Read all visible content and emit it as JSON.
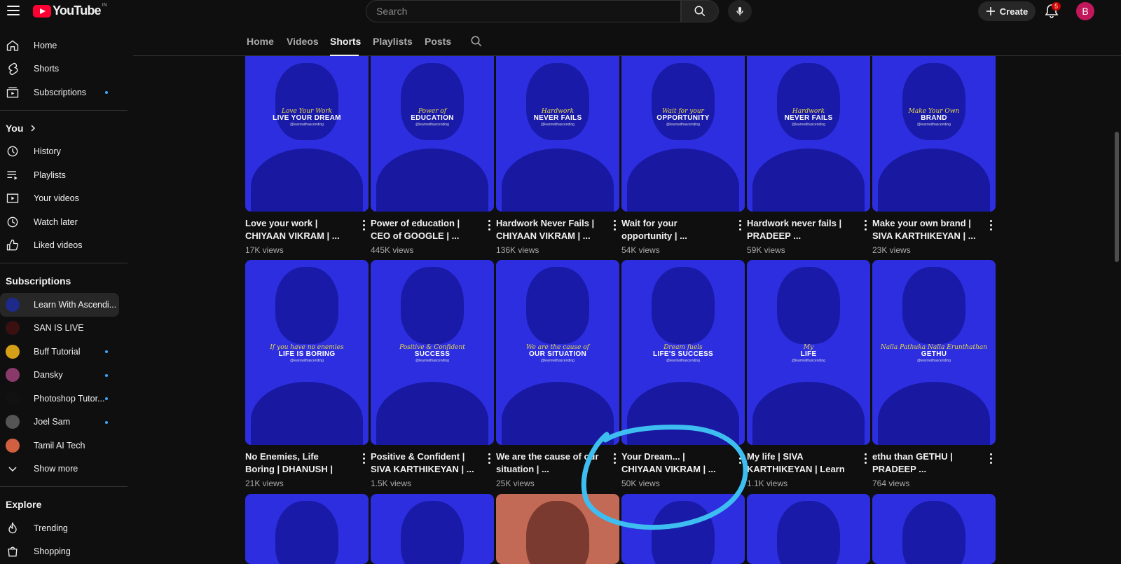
{
  "topbar": {
    "logo_text": "YouTube",
    "country_code": "IN",
    "search_placeholder": "Search",
    "create_label": "Create",
    "notification_count": "5",
    "avatar_letter": "B"
  },
  "sidebar": {
    "main": [
      {
        "label": "Home",
        "icon": "home-icon"
      },
      {
        "label": "Shorts",
        "icon": "shorts-icon"
      },
      {
        "label": "Subscriptions",
        "icon": "subscriptions-icon",
        "dot": true
      }
    ],
    "you_heading": "You",
    "you": [
      {
        "label": "History",
        "icon": "history-icon"
      },
      {
        "label": "Playlists",
        "icon": "playlists-icon"
      },
      {
        "label": "Your videos",
        "icon": "your-videos-icon"
      },
      {
        "label": "Watch later",
        "icon": "watch-later-icon"
      },
      {
        "label": "Liked videos",
        "icon": "liked-videos-icon"
      }
    ],
    "subs_heading": "Subscriptions",
    "subs": [
      {
        "label": "Learn With Ascendi...",
        "color": "#1e2a8a",
        "dot": false,
        "active": true
      },
      {
        "label": "SAN IS LIVE",
        "color": "#3a1010",
        "dot": false
      },
      {
        "label": "Buff Tutorial",
        "color": "#d4a017",
        "dot": true
      },
      {
        "label": "Dansky",
        "color": "#8a3a6a",
        "dot": true
      },
      {
        "label": "Photoshop Tutor...",
        "color": "#111111",
        "dot": true
      },
      {
        "label": "Joel Sam",
        "color": "#555555",
        "dot": true
      },
      {
        "label": "Tamil AI Tech",
        "color": "#d06040",
        "dot": false
      }
    ],
    "show_more": "Show more",
    "explore_heading": "Explore",
    "explore": [
      {
        "label": "Trending",
        "icon": "trending-icon"
      },
      {
        "label": "Shopping",
        "icon": "shopping-icon"
      }
    ]
  },
  "tabs": [
    "Home",
    "Videos",
    "Shorts",
    "Playlists",
    "Posts"
  ],
  "active_tab": "Shorts",
  "shorts_row1": [
    {
      "title": "Love your work  |  CHIYAAN VIKRAM | ...",
      "views": "17K views",
      "cap1": "Love Your Work",
      "cap2": "LIVE YOUR DREAM"
    },
    {
      "title": "Power of education | CEO of GOOGLE | ...",
      "views": "445K views",
      "cap1": "Power of",
      "cap2": "EDUCATION"
    },
    {
      "title": "Hardwork Never Fails  | CHIYAAN VIKRAM | ...",
      "views": "136K views",
      "cap1": "Hardwork",
      "cap2": "NEVER FAILS"
    },
    {
      "title": "Wait for your opportunity | ...",
      "views": "54K views",
      "cap1": "Wait for your",
      "cap2": "OPPORTUNITY"
    },
    {
      "title": "Hardwork never fails  | PRADEEP ...",
      "views": "59K views",
      "cap1": "Hardwork",
      "cap2": "NEVER FAILS"
    },
    {
      "title": "Make your own brand | SIVA KARTHIKEYAN | ...",
      "views": "23K views",
      "cap1": "Make Your Own",
      "cap2": "BRAND"
    }
  ],
  "shorts_row2": [
    {
      "title": "No Enemies, Life Boring | DHANUSH | Learn wit...",
      "views": "21K views",
      "cap1": "If you have no enemies",
      "cap2": "LIFE IS BORING"
    },
    {
      "title": "Positive & Confident | SIVA KARTHIKEYAN | ...",
      "views": "1.5K views",
      "cap1": "Positive & Confident",
      "cap2": "SUCCESS"
    },
    {
      "title": "We are the cause of our situation | ...",
      "views": "25K views",
      "cap1": "We are the cause of",
      "cap2": "OUR SITUATION"
    },
    {
      "title": "Your Dream... | CHIYAAN VIKRAM | ...",
      "views": "50K views",
      "cap1": "Dream fuels",
      "cap2": "LIFE'S SUCCESS"
    },
    {
      "title": "My life | SIVA KARTHIKEYAN | Learn ...",
      "views": "1.1K views",
      "cap1": "My",
      "cap2": "LIFE"
    },
    {
      "title": "ethu than GETHU  | PRADEEP ...",
      "views": "764 views",
      "cap1": "Nalla Pathuka Nalla Erunthathan",
      "cap2": "GETHU"
    }
  ],
  "handle_text": "@learnwithascending",
  "colors": {
    "thumb_blue": "#2d2ee0",
    "annotation": "#3ebef0",
    "accent_red": "#ff0033"
  }
}
